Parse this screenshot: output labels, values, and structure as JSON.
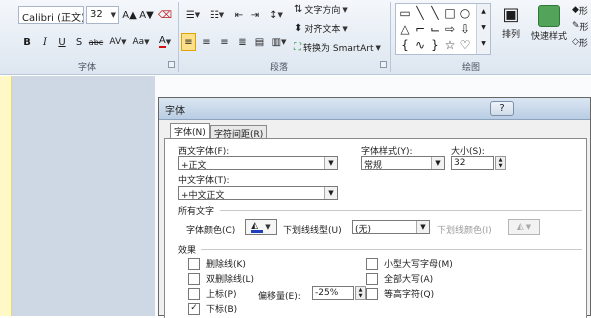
{
  "ribbon": {
    "font_group": {
      "label": "字体",
      "font_name": "Calibri (正文)",
      "font_size": "32",
      "grow_icon": "A▲",
      "shrink_icon": "A▼",
      "format_buttons": [
        "B",
        "I",
        "U",
        "S",
        "abc",
        "AV",
        "Aa",
        "A"
      ]
    },
    "paragraph_group": {
      "label": "段落",
      "text_direction": "文字方向",
      "align_text": "对齐文本",
      "smartart": "转换为 SmartArt"
    },
    "drawing_group": {
      "label": "绘图",
      "arrange": "排列",
      "quick_styles": "快速样式",
      "right_labels": [
        "形",
        "形",
        "形"
      ]
    }
  },
  "dialog": {
    "title": "字体",
    "help_icon": "?",
    "close_icon": "✕",
    "tabs": [
      {
        "label": "字体(N)",
        "selected": true
      },
      {
        "label": "字符间距(R)",
        "selected": false
      }
    ],
    "western_font_label": "西文字体(F):",
    "western_font_value": "+正文",
    "asian_font_label": "中文字体(T):",
    "asian_font_value": "+中文正文",
    "style_label": "字体样式(Y):",
    "style_value": "常规",
    "size_label": "大小(S):",
    "size_value": "32",
    "all_text_label": "所有文字",
    "font_color_label": "字体颜色(C)",
    "underline_type_label": "下划线线型(U)",
    "underline_type_value": "(无)",
    "underline_color_label": "下划线颜色(I)",
    "effects_label": "效果",
    "effects_left": [
      {
        "label": "删除线(K)",
        "checked": false
      },
      {
        "label": "双删除线(L)",
        "checked": false
      },
      {
        "label": "上标(P)",
        "checked": false
      },
      {
        "label": "下标(B)",
        "checked": true
      }
    ],
    "offset_label": "偏移量(E):",
    "offset_value": "-25%",
    "effects_right": [
      {
        "label": "小型大写字母(M)",
        "checked": false
      },
      {
        "label": "全部大写(A)",
        "checked": false
      },
      {
        "label": "等高字符(Q)",
        "checked": false
      }
    ],
    "check_mark": "✓",
    "font_color_hex": "#1f3fbf",
    "accent_hex": "#ffe08a"
  }
}
